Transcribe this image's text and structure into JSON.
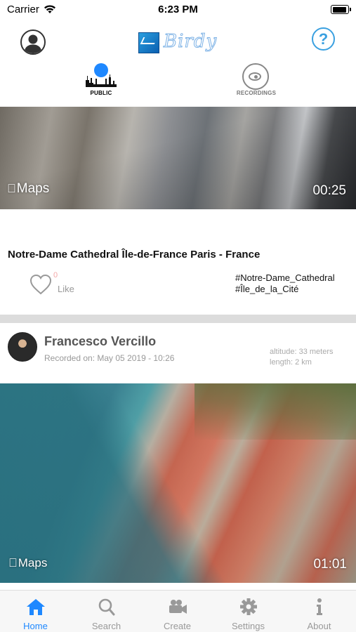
{
  "status_bar": {
    "carrier": "Carrier",
    "time": "6:23 PM"
  },
  "header": {
    "logo_text": "Birdy"
  },
  "segments": [
    {
      "label": "PUBLIC",
      "active": true
    },
    {
      "label": "RECORDINGS",
      "active": false
    }
  ],
  "feed": {
    "card1": {
      "maps_label": "Maps",
      "duration": "00:25",
      "title": "Notre-Dame Cathedral Île-de-France Paris - France",
      "like_count": "0",
      "like_label": "Like",
      "tags": [
        "#Notre-Dame_Cathedral",
        "#Île_de_la_Cité"
      ]
    },
    "card2": {
      "author": "Francesco Vercillo",
      "recorded_on": "Recorded on: May 05 2019 - 10:26",
      "altitude": "altitude: 33 meters",
      "length": "length: 2 km",
      "maps_label": "Maps",
      "duration": "01:01"
    }
  },
  "tabbar": [
    {
      "label": "Home",
      "icon": "home-icon",
      "active": true
    },
    {
      "label": "Search",
      "icon": "search-icon",
      "active": false
    },
    {
      "label": "Create",
      "icon": "video-camera-icon",
      "active": false
    },
    {
      "label": "Settings",
      "icon": "gear-icon",
      "active": false
    },
    {
      "label": "About",
      "icon": "info-icon",
      "active": false
    }
  ],
  "colors": {
    "accent": "#1e88ff",
    "like_count": "#f4a7a7",
    "help": "#3aa0e0"
  }
}
